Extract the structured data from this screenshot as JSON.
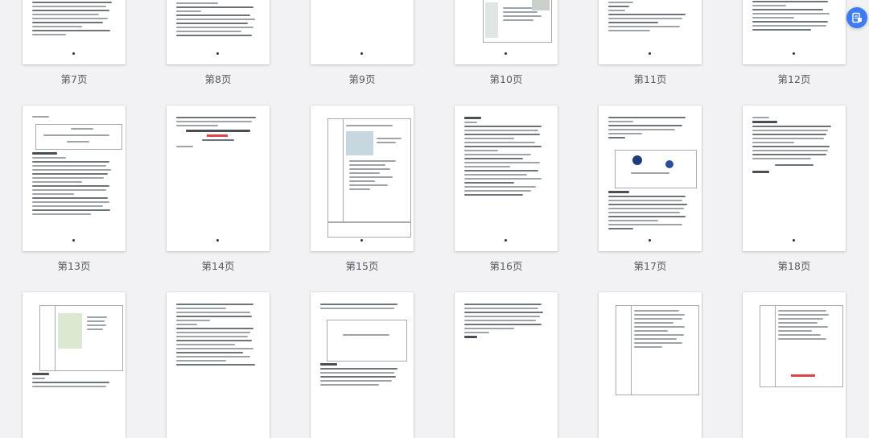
{
  "thumbnails": {
    "row1": [
      "第7页",
      "第8页",
      "第9页",
      "第10页",
      "第11页",
      "第12页"
    ],
    "row2": [
      "第13页",
      "第14页",
      "第15页",
      "第16页",
      "第17页",
      "第18页"
    ]
  },
  "colors": {
    "background": "#f2f2f4",
    "page": "#ffffff",
    "accent": "#3d7bf2"
  },
  "icons": {
    "floating_button": "document-export-icon"
  }
}
